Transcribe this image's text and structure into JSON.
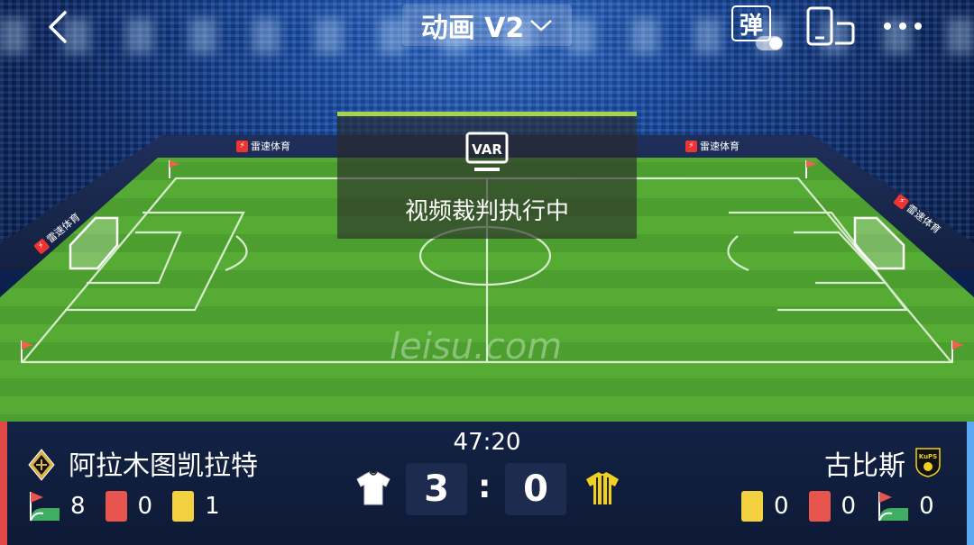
{
  "header": {
    "mode_label": "动画 V2",
    "danmu_label": "弹"
  },
  "var_panel": {
    "badge": "VAR",
    "message": "视频裁判执行中"
  },
  "watermark": "leisu.com",
  "sponsor": "雷速体育",
  "match": {
    "clock": "47:20",
    "home": {
      "name": "阿拉木图凯拉特",
      "score": "3",
      "corners": "8",
      "red_cards": "0",
      "yellow_cards": "1",
      "color": "#e04848",
      "jersey_color": "#ffffff"
    },
    "away": {
      "name": "古比斯",
      "logo_text": "KuPS",
      "score": "0",
      "corners": "0",
      "red_cards": "0",
      "yellow_cards": "0",
      "color": "#5aa7f2",
      "jersey_color": "#f0d020"
    },
    "colon": ":"
  },
  "colors": {
    "pitch_light": "#55ab34",
    "pitch_dark": "#3f9428",
    "var_bar": "#a6d54a"
  }
}
